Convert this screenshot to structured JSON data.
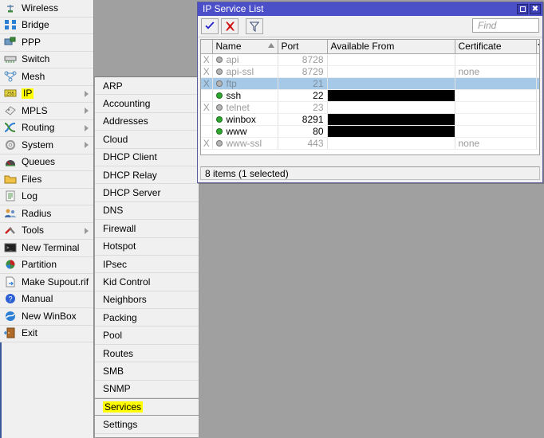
{
  "colors": {
    "titlebar": "#4b4fc8",
    "selection": "#a6c9e8",
    "highlight": "#ffff00",
    "desktop": "#a0a0a0",
    "panel": "#f0f0f0",
    "enabled_dot": "#2ea82e",
    "disabled_dot": "#b4b4b4"
  },
  "sidebar": {
    "items": [
      {
        "label": "Wireless",
        "icon": "antenna-icon",
        "arrow": false
      },
      {
        "label": "Bridge",
        "icon": "bridge-icon",
        "arrow": false
      },
      {
        "label": "PPP",
        "icon": "ppp-icon",
        "arrow": false
      },
      {
        "label": "Switch",
        "icon": "switch-icon",
        "arrow": false
      },
      {
        "label": "Mesh",
        "icon": "mesh-icon",
        "arrow": false
      },
      {
        "label": "IP",
        "icon": "ip-icon",
        "arrow": true,
        "highlighted": true
      },
      {
        "label": "MPLS",
        "icon": "mpls-icon",
        "arrow": true
      },
      {
        "label": "Routing",
        "icon": "routing-icon",
        "arrow": true
      },
      {
        "label": "System",
        "icon": "gear-icon",
        "arrow": true
      },
      {
        "label": "Queues",
        "icon": "queues-icon",
        "arrow": false
      },
      {
        "label": "Files",
        "icon": "folder-icon",
        "arrow": false
      },
      {
        "label": "Log",
        "icon": "log-icon",
        "arrow": false
      },
      {
        "label": "Radius",
        "icon": "radius-users-icon",
        "arrow": false
      },
      {
        "label": "Tools",
        "icon": "tools-icon",
        "arrow": true
      },
      {
        "label": "New Terminal",
        "icon": "terminal-icon",
        "arrow": false
      },
      {
        "label": "Partition",
        "icon": "partition-icon",
        "arrow": false
      },
      {
        "label": "Make Supout.rif",
        "icon": "document-icon",
        "arrow": false
      },
      {
        "label": "Manual",
        "icon": "help-icon",
        "arrow": false
      },
      {
        "label": "New WinBox",
        "icon": "winbox-icon",
        "arrow": false
      },
      {
        "label": "Exit",
        "icon": "exit-door-icon",
        "arrow": false
      }
    ]
  },
  "submenu": {
    "items": [
      {
        "label": "ARP"
      },
      {
        "label": "Accounting"
      },
      {
        "label": "Addresses"
      },
      {
        "label": "Cloud"
      },
      {
        "label": "DHCP Client"
      },
      {
        "label": "DHCP Relay"
      },
      {
        "label": "DHCP Server"
      },
      {
        "label": "DNS"
      },
      {
        "label": "Firewall"
      },
      {
        "label": "Hotspot"
      },
      {
        "label": "IPsec"
      },
      {
        "label": "Kid Control"
      },
      {
        "label": "Neighbors"
      },
      {
        "label": "Packing"
      },
      {
        "label": "Pool"
      },
      {
        "label": "Routes"
      },
      {
        "label": "SMB"
      },
      {
        "label": "SNMP"
      },
      {
        "label": "Services",
        "highlighted": true,
        "active": true
      },
      {
        "label": "Settings"
      }
    ]
  },
  "window": {
    "title": "IP Service List",
    "buttons": {
      "maximize": "maximize-button",
      "close": "✖"
    },
    "toolbar": {
      "enable_label": "✔",
      "disable_label": "✖",
      "filter_label": "filter"
    },
    "find": {
      "placeholder": "Find",
      "value": ""
    },
    "table": {
      "columns": [
        "",
        "Name",
        "Port",
        "Available From",
        "Certificate",
        ""
      ],
      "sort_column": "Name",
      "rows": [
        {
          "flag": "X",
          "name": "api",
          "port": "8728",
          "available_from": "",
          "available_redacted": false,
          "certificate": "",
          "enabled": false
        },
        {
          "flag": "X",
          "name": "api-ssl",
          "port": "8729",
          "available_from": "",
          "available_redacted": false,
          "certificate": "none",
          "enabled": false
        },
        {
          "flag": "X",
          "name": "ftp",
          "port": "21",
          "available_from": "",
          "available_redacted": false,
          "certificate": "",
          "enabled": false,
          "selected": true
        },
        {
          "flag": "",
          "name": "ssh",
          "port": "22",
          "available_from": "",
          "available_redacted": true,
          "certificate": "",
          "enabled": true
        },
        {
          "flag": "X",
          "name": "telnet",
          "port": "23",
          "available_from": "",
          "available_redacted": false,
          "certificate": "",
          "enabled": false
        },
        {
          "flag": "",
          "name": "winbox",
          "port": "8291",
          "available_from": "",
          "available_redacted": true,
          "certificate": "",
          "enabled": true
        },
        {
          "flag": "",
          "name": "www",
          "port": "80",
          "available_from": "",
          "available_redacted": true,
          "certificate": "",
          "enabled": true
        },
        {
          "flag": "X",
          "name": "www-ssl",
          "port": "443",
          "available_from": "",
          "available_redacted": false,
          "certificate": "none",
          "enabled": false
        }
      ]
    },
    "status": "8 items (1 selected)"
  }
}
